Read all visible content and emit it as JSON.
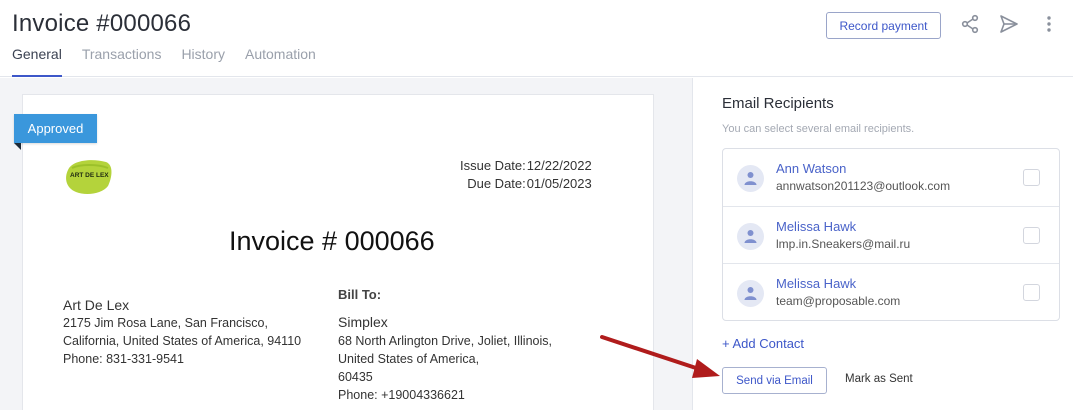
{
  "header": {
    "title": "Invoice #000066",
    "record_payment_label": "Record payment",
    "icons": [
      "share-icon",
      "send-icon",
      "more-vertical-icon"
    ]
  },
  "tabs": [
    {
      "label": "General",
      "active": true
    },
    {
      "label": "Transactions",
      "active": false
    },
    {
      "label": "History",
      "active": false
    },
    {
      "label": "Automation",
      "active": false
    }
  ],
  "invoice": {
    "status_badge": "Approved",
    "logo_text": "ART DE LEX",
    "issue_date_label": "Issue Date:",
    "issue_date": "12/22/2022",
    "due_date_label": "Due Date:",
    "due_date": "01/05/2023",
    "title": "Invoice # 000066",
    "from": {
      "name": "Art De Lex",
      "address_line1": "2175 Jim Rosa Lane, San Francisco,",
      "address_line2": "California, United States of America, 94110",
      "phone": "Phone: 831-331-9541"
    },
    "bill_to_label": "Bill To:",
    "bill_to": {
      "name": "Simplex",
      "address_line1": "68 North Arlington Drive, Joliet, Illinois,",
      "address_line2": "United States of America,",
      "address_line3": "60435",
      "phone": "Phone: +19004336621"
    }
  },
  "email_panel": {
    "title": "Email Recipients",
    "subtitle": "You can select several email recipients.",
    "recipients": [
      {
        "name": "Ann Watson",
        "email": "annwatson201123@outlook.com",
        "checked": false
      },
      {
        "name": "Melissa Hawk",
        "email": "lmp.in.Sneakers@mail.ru",
        "checked": false
      },
      {
        "name": "Melissa Hawk",
        "email": "team@proposable.com",
        "checked": false
      }
    ],
    "add_contact_label": "+ Add Contact",
    "send_label": "Send via Email",
    "mark_sent_label": "Mark as Sent"
  },
  "colors": {
    "accent": "#3d57c9",
    "badge": "#3a97dc",
    "arrow": "#b01c1c"
  }
}
